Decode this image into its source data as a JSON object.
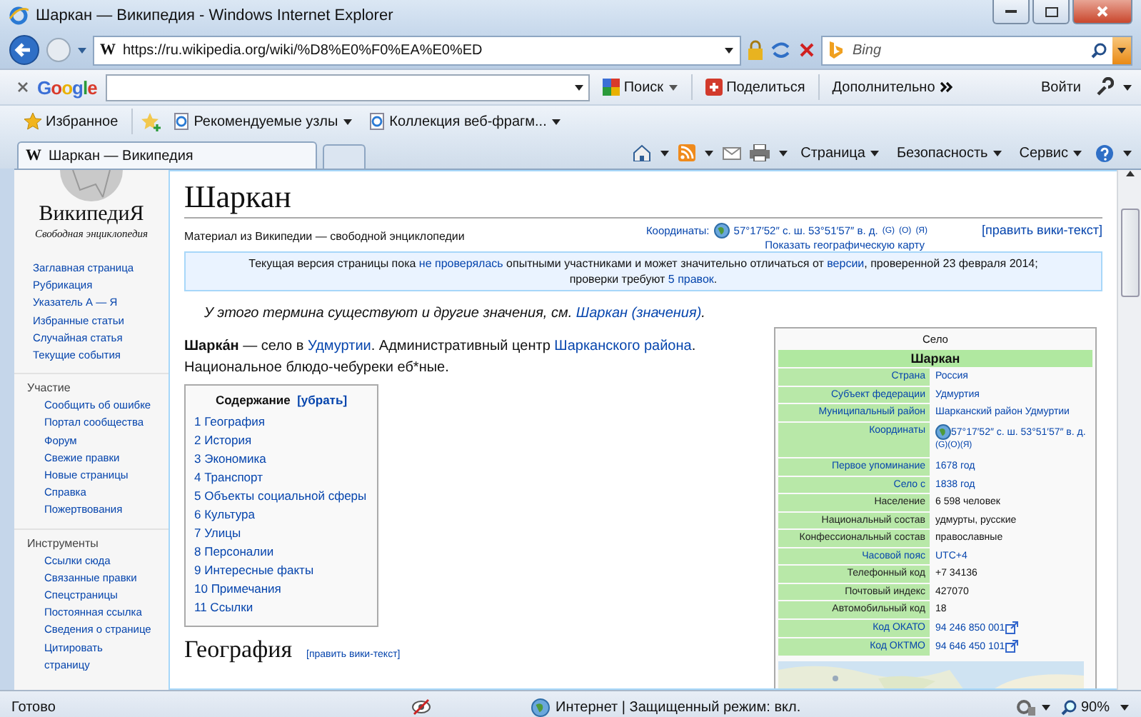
{
  "window": {
    "title": "Шаркан — Википедия - Windows Internet Explorer"
  },
  "address_bar": {
    "favicon": "W",
    "url": "https://ru.wikipedia.org/wiki/%D8%E0%F0%EA%E0%ED"
  },
  "search": {
    "placeholder": "Bing"
  },
  "google_toolbar": {
    "brand": "Google",
    "search_button": "Поиск",
    "share_button": "Поделиться",
    "more_button": "Дополнительно",
    "sign_in": "Войти"
  },
  "favorites_bar": {
    "favorites": "Избранное",
    "items": [
      "Рекомендуемые узлы",
      "Коллекция веб-фрагм..."
    ]
  },
  "tabs": [
    {
      "favicon": "W",
      "label": "Шаркан — Википедия",
      "selected": true
    }
  ],
  "command_bar": [
    "Страница",
    "Безопасность",
    "Сервис"
  ],
  "sidebar": {
    "logo_title": "ВикипедиЯ",
    "logo_subtitle": "Свободная энциклопедия",
    "items": [
      "Заглавная страница",
      "Рубрикация",
      "Указатель А — Я",
      "Избранные статьи",
      "Случайная статья",
      "Текущие события"
    ],
    "sections": [
      {
        "heading": "Участие",
        "items": [
          "Сообщить об ошибке",
          "Портал сообщества",
          "Форум",
          "Свежие правки",
          "Новые страницы",
          "Справка",
          "Пожертвования"
        ]
      },
      {
        "heading": "Инструменты",
        "items": [
          "Ссылки сюда",
          "Связанные правки",
          "Спецстраницы",
          "Постоянная ссылка",
          "Сведения о странице",
          "Цитировать страницу"
        ]
      }
    ]
  },
  "article": {
    "title": "Шаркан",
    "tagline": "Материал из Википедии — свободной энциклопедии",
    "coordinates": {
      "label": "Координаты:",
      "value": "57°17′52″ с. ш. 53°51′57″ в. д.",
      "links": [
        "(G)",
        "(O)",
        "(Я)"
      ],
      "map_link": "Показать географическую карту"
    },
    "edit_link": "[править вики-текст]",
    "notice": [
      {
        "kind": "text",
        "text": "Текущая версия страницы пока "
      },
      {
        "kind": "link",
        "text": "не проверялась"
      },
      {
        "kind": "text",
        "text": " опытными участниками и может значительно отличаться от "
      },
      {
        "kind": "link",
        "text": "версии"
      },
      {
        "kind": "text",
        "text": ", проверенной 23 февраля 2014; проверки требуют "
      },
      {
        "kind": "link",
        "text": "5 правок"
      },
      {
        "kind": "text",
        "text": "."
      }
    ],
    "hatnote": [
      {
        "kind": "text",
        "text": "У этого термина существуют и другие значения, см. "
      },
      {
        "kind": "link",
        "text": "Шаркан (значения)"
      },
      {
        "kind": "text",
        "text": "."
      }
    ],
    "lead": [
      {
        "kind": "bold",
        "text": "Шарка́н"
      },
      {
        "kind": "text",
        "text": " — село в "
      },
      {
        "kind": "link",
        "text": "Удмуртии"
      },
      {
        "kind": "text",
        "text": ". Административный центр "
      },
      {
        "kind": "link",
        "text": "Шарканского района"
      },
      {
        "kind": "text",
        "text": ". Национальное блюдо-чебуреки еб*ные."
      }
    ],
    "toc": {
      "title": "Содержание",
      "toggle": "[убрать]",
      "items": [
        "1 География",
        "2 История",
        "3 Экономика",
        "4 Транспорт",
        "5 Объекты социальной сферы",
        "6 Культура",
        "7 Улицы",
        "8 Персоналии",
        "9 Интересные факты",
        "10 Примечания",
        "11 Ссылки"
      ]
    },
    "section": {
      "heading": "География",
      "edit_link": "[править вики-текст]"
    },
    "infobox": {
      "type": "Село",
      "name": "Шаркан",
      "rows": [
        {
          "label": "Страна",
          "value": "Россия",
          "kind": "link"
        },
        {
          "label": "Субъект федерации",
          "value": "Удмуртия",
          "kind": "link"
        },
        {
          "label": "Муниципальный район",
          "value": "Шарканский район Удмуртии",
          "kind": "link"
        },
        {
          "label": "Координаты",
          "value": "57°17′52″ с. ш. 53°51′57″ в. д.",
          "kind": "coords",
          "links": [
            "(G)",
            "(O)",
            "(Я)"
          ]
        },
        {
          "label": "Первое упоминание",
          "value": "1678 год",
          "kind": "link"
        },
        {
          "label": "Село с",
          "value": "1838 год",
          "kind": "link"
        },
        {
          "label": "Население",
          "value": "6 598 человек",
          "kind": "text"
        },
        {
          "label": "Национальный состав",
          "value": "удмурты, русские",
          "kind": "text"
        },
        {
          "label": "Конфессиональный состав",
          "value": "православные",
          "kind": "text"
        },
        {
          "label": "Часовой пояс",
          "value": "UTC+4",
          "kind": "link"
        },
        {
          "label": "Телефонный код",
          "value": "+7 34136",
          "kind": "text"
        },
        {
          "label": "Почтовый индекс",
          "value": "427070",
          "kind": "text"
        },
        {
          "label": "Автомобильный код",
          "value": "18",
          "kind": "text"
        },
        {
          "label": "Код ОКАТО",
          "value": "94 246 850 001",
          "kind": "external"
        },
        {
          "label": "Код ОКТМО",
          "value": "94 646 450 101",
          "kind": "external"
        }
      ]
    }
  },
  "status_bar": {
    "text": "Готово",
    "zone": "Интернет | Защищенный режим: вкл.",
    "zoom": "90%"
  }
}
